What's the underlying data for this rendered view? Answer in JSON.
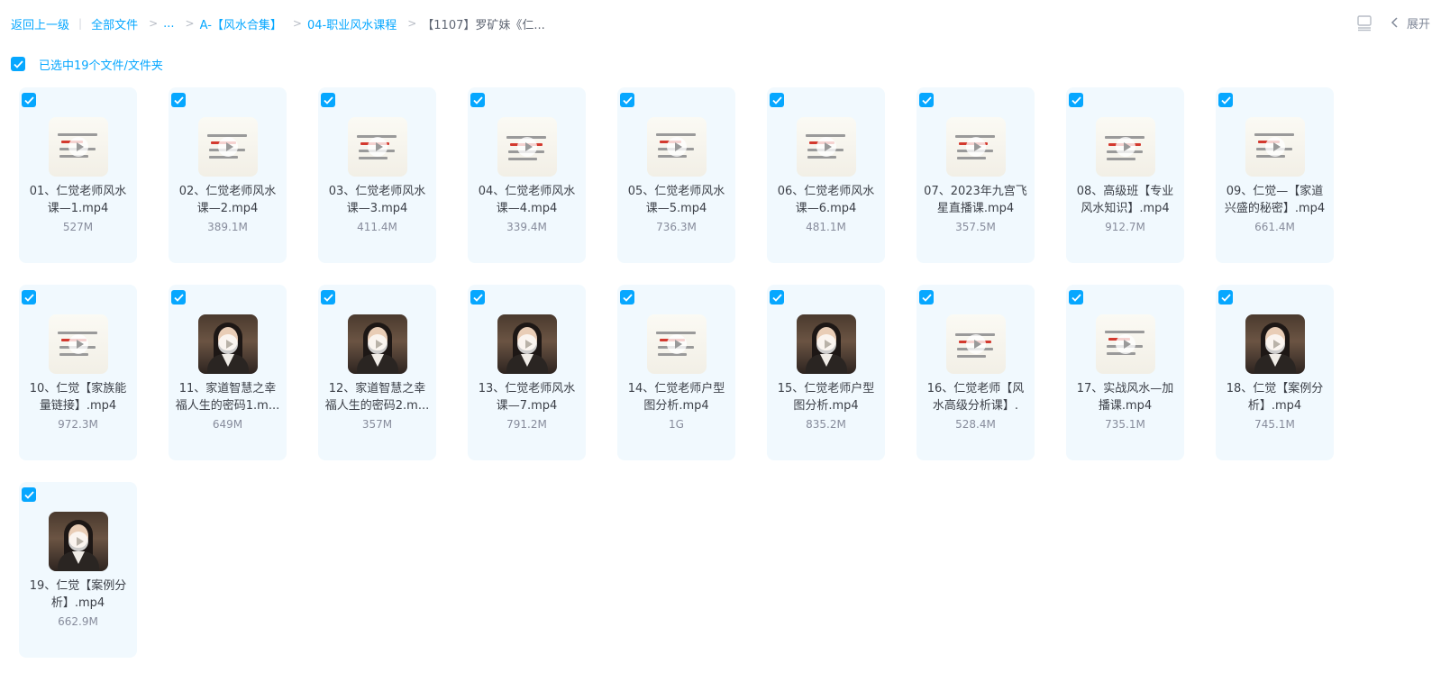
{
  "breadcrumb": {
    "back": "返回上一级",
    "all_files": "全部文件",
    "ellipsis": "...",
    "level1": "A-【风水合集】",
    "level2": "04-职业风水课程",
    "current": "【1107】罗矿妹《仁..."
  },
  "toolbar": {
    "expand_label": "展开"
  },
  "selection": {
    "text": "已选中19个文件/文件夹"
  },
  "files": [
    {
      "name": "01、仁觉老师风水课—1.mp4",
      "size": "527M",
      "thumb": "slide"
    },
    {
      "name": "02、仁觉老师风水课—2.mp4",
      "size": "389.1M",
      "thumb": "slide"
    },
    {
      "name": "03、仁觉老师风水课—3.mp4",
      "size": "411.4M",
      "thumb": "slide"
    },
    {
      "name": "04、仁觉老师风水课—4.mp4",
      "size": "339.4M",
      "thumb": "slide"
    },
    {
      "name": "05、仁觉老师风水课—5.mp4",
      "size": "736.3M",
      "thumb": "slide"
    },
    {
      "name": "06、仁觉老师风水课—6.mp4",
      "size": "481.1M",
      "thumb": "slide"
    },
    {
      "name": "07、2023年九宫飞星直播课.mp4",
      "size": "357.5M",
      "thumb": "slide"
    },
    {
      "name": "08、高级班【专业风水知识】.mp4",
      "size": "912.7M",
      "thumb": "slide"
    },
    {
      "name": "09、仁觉—【家道兴盛的秘密】.mp4",
      "size": "661.4M",
      "thumb": "slide"
    },
    {
      "name": "10、仁觉【家族能量链接】.mp4",
      "size": "972.3M",
      "thumb": "slide"
    },
    {
      "name": "11、家道智慧之幸福人生的密码1.m...",
      "size": "649M",
      "thumb": "video"
    },
    {
      "name": "12、家道智慧之幸福人生的密码2.m...",
      "size": "357M",
      "thumb": "video"
    },
    {
      "name": "13、仁觉老师风水课—7.mp4",
      "size": "791.2M",
      "thumb": "video"
    },
    {
      "name": "14、仁觉老师户型图分析.mp4",
      "size": "1G",
      "thumb": "slide"
    },
    {
      "name": "15、仁觉老师户型图分析.mp4",
      "size": "835.2M",
      "thumb": "video"
    },
    {
      "name": "16、仁觉老师【风水高级分析课】.",
      "size": "528.4M",
      "thumb": "slide"
    },
    {
      "name": "17、实战风水—加播课.mp4",
      "size": "735.1M",
      "thumb": "slide"
    },
    {
      "name": "18、仁觉【案例分析】.mp4",
      "size": "745.1M",
      "thumb": "video"
    },
    {
      "name": "19、仁觉【案例分析】.mp4",
      "size": "662.9M",
      "thumb": "video"
    }
  ],
  "colors": {
    "accent": "#06a7ff",
    "tile_bg": "#f1f9fe"
  }
}
